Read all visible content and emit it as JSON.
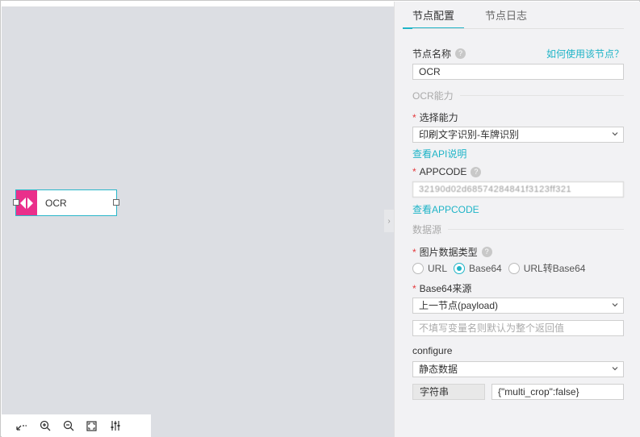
{
  "node": {
    "label": "OCR"
  },
  "panel": {
    "tabs": [
      {
        "label": "节点配置"
      },
      {
        "label": "节点日志"
      }
    ],
    "node_name": {
      "label": "节点名称",
      "value": "OCR",
      "help_link": "如何使用该节点？"
    },
    "section_ocr": "OCR能力",
    "capability": {
      "label": "选择能力",
      "value": "印刷文字识别-车牌识别",
      "link": "查看API说明"
    },
    "appcode": {
      "label": "APPCODE",
      "value": "32190d02d68574284841f3123ff321",
      "link": "查看APPCODE"
    },
    "section_data": "数据源",
    "image_type": {
      "label": "图片数据类型",
      "options": [
        {
          "label": "URL"
        },
        {
          "label": "Base64"
        },
        {
          "label": "URL转Base64"
        }
      ],
      "selected": "Base64"
    },
    "base64_source": {
      "label": "Base64来源",
      "value": "上一节点(payload)"
    },
    "variable": {
      "placeholder": "不填写变量名则默认为整个返回值"
    },
    "configure": {
      "label": "configure",
      "value": "静态数据",
      "type": "字符串",
      "content": "{\"multi_crop\":false}"
    }
  },
  "colors": {
    "accent": "#1fb4c7",
    "node_icon": "#ea2f8b",
    "required": "#e4393c"
  },
  "toolbar": {
    "icons": [
      "fit-arrow-icon",
      "zoom-in-icon",
      "zoom-out-icon",
      "fullscreen-icon",
      "settings-sliders-icon"
    ]
  }
}
